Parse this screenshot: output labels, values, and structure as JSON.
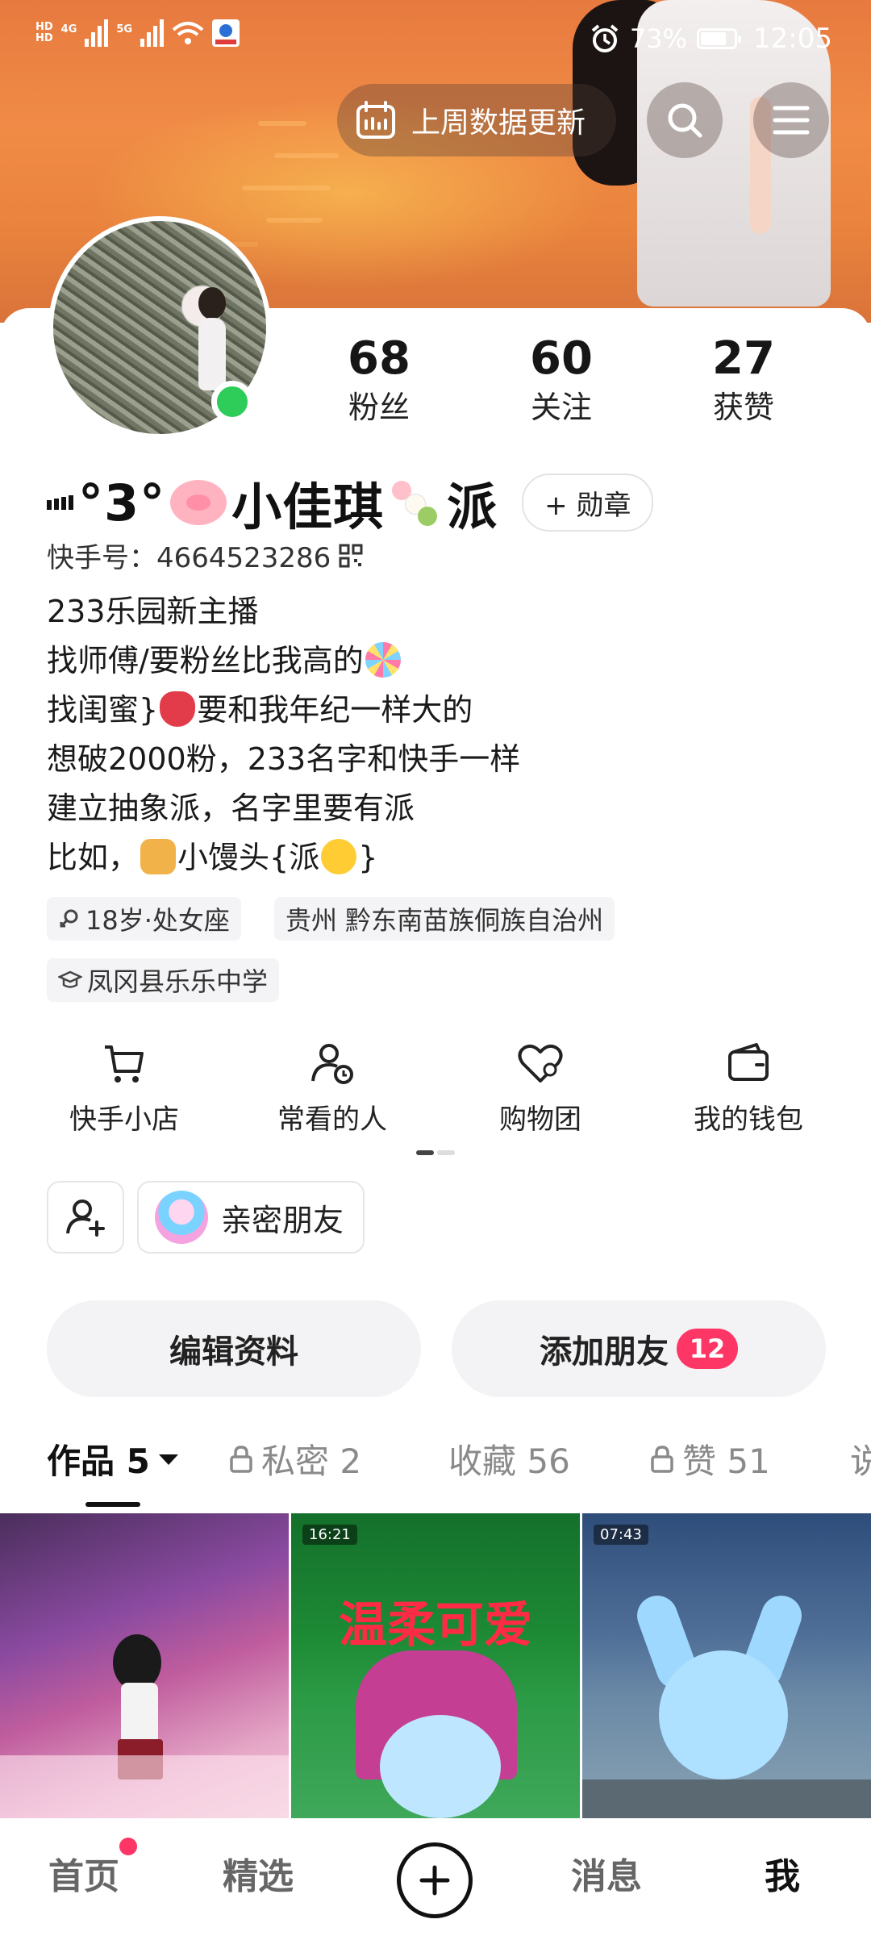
{
  "status_bar": {
    "network_1": "HD",
    "network_2": "HD",
    "gen_1": "4G",
    "gen_2": "5G",
    "battery": "73%",
    "time": "12:05"
  },
  "header": {
    "update_label": "上周数据更新"
  },
  "profile": {
    "stats": [
      {
        "value": "68",
        "label": "粉丝"
      },
      {
        "value": "60",
        "label": "关注"
      },
      {
        "value": "27",
        "label": "获赞"
      }
    ],
    "name_prefix": "°3°",
    "name_main": "小佳琪",
    "name_suffix": "派",
    "medal_label": "+ 勋章",
    "kuaishou_id": "快手号：4664523286",
    "bio_lines": [
      "233乐园新主播",
      "找师傅/要粉丝比我高的",
      "找闺蜜}",
      "要和我年纪一样大的",
      "想破2000粉，233名字和快手一样",
      "建立抽象派，名字里要有派",
      "比如，",
      "小馒头{派",
      "}"
    ],
    "tags": {
      "age": "18岁·处女座",
      "location": "贵州 黔东南苗族侗族自治州",
      "school": "凤冈县乐乐中学"
    }
  },
  "shortcuts": [
    {
      "label": "快手小店",
      "icon": "cart-icon"
    },
    {
      "label": "常看的人",
      "icon": "person-clock-icon"
    },
    {
      "label": "购物团",
      "icon": "heart-group-icon"
    },
    {
      "label": "我的钱包",
      "icon": "wallet-icon"
    }
  ],
  "close_friends_label": "亲密朋友",
  "actions": {
    "edit_profile": "编辑资料",
    "add_friends": "添加朋友",
    "add_friends_badge": "12"
  },
  "tabs": [
    {
      "label": "作品 5"
    },
    {
      "label": "私密 2"
    },
    {
      "label": "收藏 56"
    },
    {
      "label": "赞 51"
    },
    {
      "label": "说"
    }
  ],
  "videos": [
    {
      "duration": ""
    },
    {
      "duration": "16:21",
      "overlay_text": "温柔可爱"
    },
    {
      "duration": "07:43"
    }
  ],
  "bottom_nav": {
    "home": "首页",
    "featured": "精选",
    "messages": "消息",
    "me": "我"
  },
  "colors": {
    "accent_red": "#fe3666",
    "online_green": "#2ecc59"
  }
}
